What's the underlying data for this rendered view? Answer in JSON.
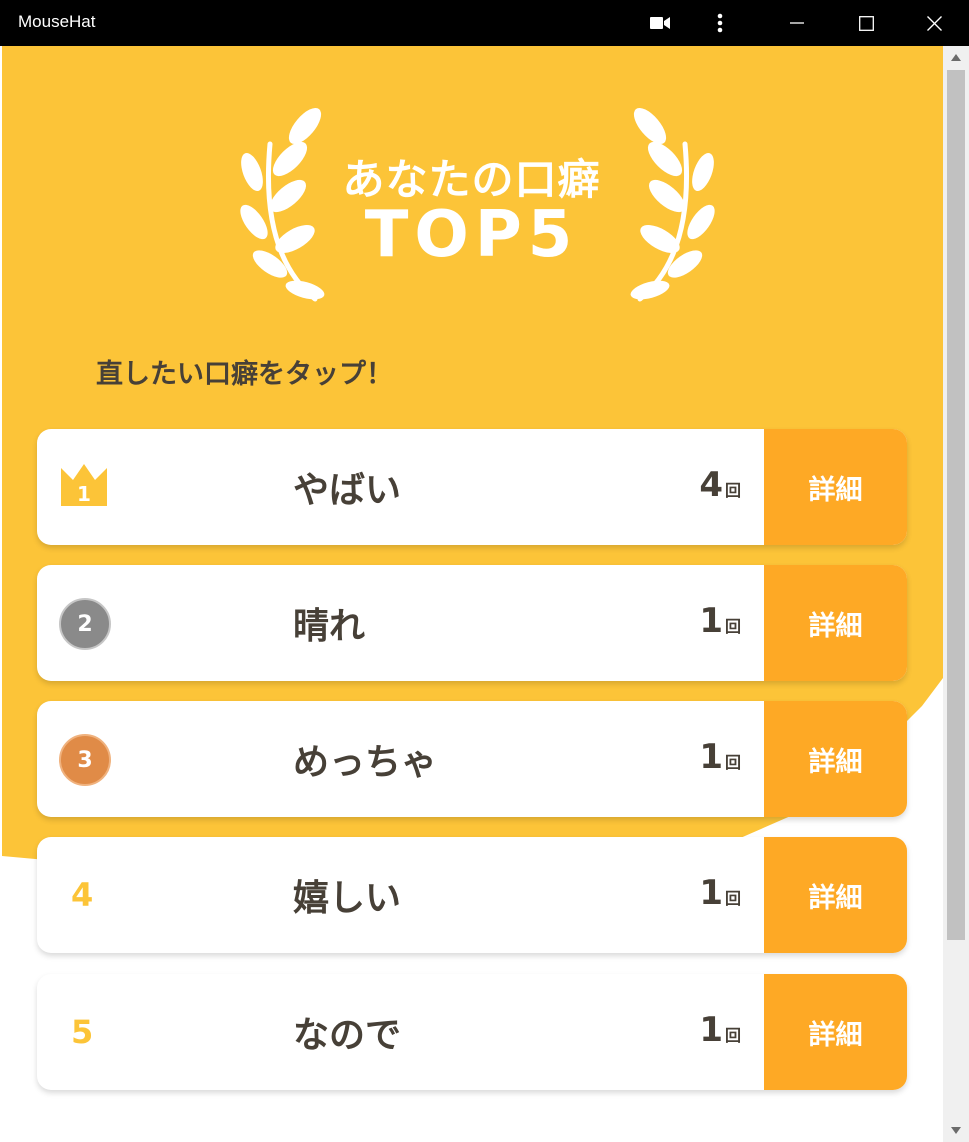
{
  "window": {
    "title": "MouseHat",
    "icons": [
      "video-camera-icon",
      "more-vert-icon",
      "minimize-icon",
      "maximize-icon",
      "close-icon"
    ]
  },
  "hero": {
    "line1": "あなたの口癖",
    "line2": "TOP5"
  },
  "subtitle": "直したい口癖をタップ！",
  "ranking": [
    {
      "rank": "1",
      "word": "やばい",
      "count": "4",
      "unit": "回",
      "detail_label": "詳細"
    },
    {
      "rank": "2",
      "word": "晴れ",
      "count": "1",
      "unit": "回",
      "detail_label": "詳細"
    },
    {
      "rank": "3",
      "word": "めっちゃ",
      "count": "1",
      "unit": "回",
      "detail_label": "詳細"
    },
    {
      "rank": "4",
      "word": "嬉しい",
      "count": "1",
      "unit": "回",
      "detail_label": "詳細"
    },
    {
      "rank": "5",
      "word": "なので",
      "count": "1",
      "unit": "回",
      "detail_label": "詳細"
    }
  ],
  "colors": {
    "accent": "#fcc438",
    "detail_button": "#fea925",
    "text": "#474037",
    "silver": "#8a8a8a",
    "bronze": "#e08b47"
  }
}
